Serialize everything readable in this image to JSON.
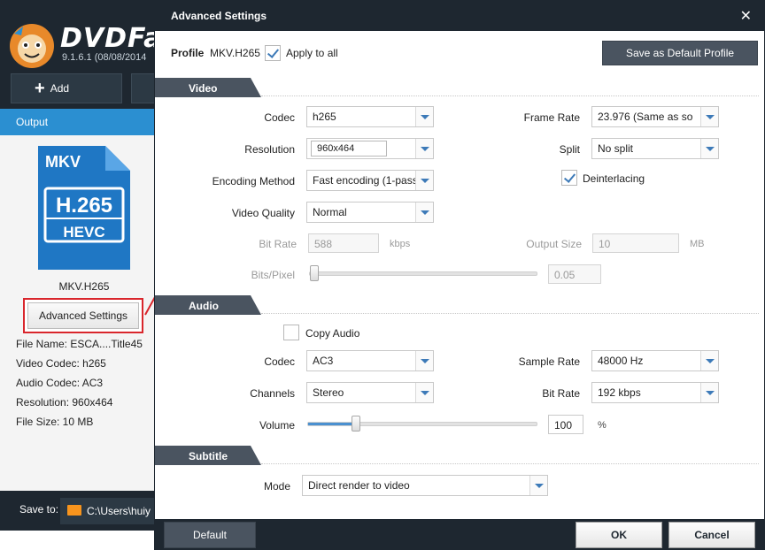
{
  "app": {
    "brand": "DVDFab",
    "version": "9.1.6.1 (08/08/2014",
    "add_label": "Add",
    "output_tab": "Output",
    "file_icon": {
      "top_text": "MKV",
      "codec_text": "H.265",
      "sub_text": "HEVC"
    },
    "profile_name": "MKV.H265",
    "advanced_settings_label": "Advanced Settings",
    "info": [
      "File Name: ESCA....Title45",
      "Video Codec: h265",
      "Audio Codec: AC3",
      "Resolution: 960x464",
      "File Size: 10 MB"
    ],
    "save_to_label": "Save to:",
    "save_to_path": "C:\\Users\\huiy"
  },
  "dialog": {
    "title": "Advanced Settings",
    "close_glyph": "✕",
    "profile_label": "Profile",
    "profile_value": "MKV.H265",
    "apply_to_all_label": "Apply to all",
    "apply_to_all_checked": true,
    "save_default_label": "Save as Default Profile",
    "video": {
      "section_label": "Video",
      "codec_label": "Codec",
      "codec_value": "h265",
      "resolution_label": "Resolution",
      "resolution_value": "960x464",
      "encoding_label": "Encoding Method",
      "encoding_value": "Fast encoding (1-pass",
      "quality_label": "Video Quality",
      "quality_value": "Normal",
      "bitrate_label": "Bit Rate",
      "bitrate_value": "588",
      "bitrate_unit": "kbps",
      "bitspixel_label": "Bits/Pixel",
      "bitspixel_value": "0.05",
      "framerate_label": "Frame Rate",
      "framerate_value": "23.976 (Same as so",
      "split_label": "Split",
      "split_value": "No split",
      "deinterlacing_label": "Deinterlacing",
      "deinterlacing_checked": true,
      "outputsize_label": "Output Size",
      "outputsize_value": "10",
      "outputsize_unit": "MB"
    },
    "audio": {
      "section_label": "Audio",
      "copy_audio_label": "Copy Audio",
      "copy_audio_checked": false,
      "codec_label": "Codec",
      "codec_value": "AC3",
      "channels_label": "Channels",
      "channels_value": "Stereo",
      "samplerate_label": "Sample Rate",
      "samplerate_value": "48000 Hz",
      "bitrate_label": "Bit Rate",
      "bitrate_value": "192 kbps",
      "volume_label": "Volume",
      "volume_value": "100",
      "volume_unit": "%"
    },
    "subtitle": {
      "section_label": "Subtitle",
      "mode_label": "Mode",
      "mode_value": "Direct render to video"
    },
    "footer": {
      "default_label": "Default",
      "ok_label": "OK",
      "cancel_label": "Cancel"
    }
  },
  "colors": {
    "titlebar": "#1e2730",
    "section_header": "#4a5460",
    "accent_blue": "#2b8fd1",
    "highlight_red": "#d9262c"
  }
}
